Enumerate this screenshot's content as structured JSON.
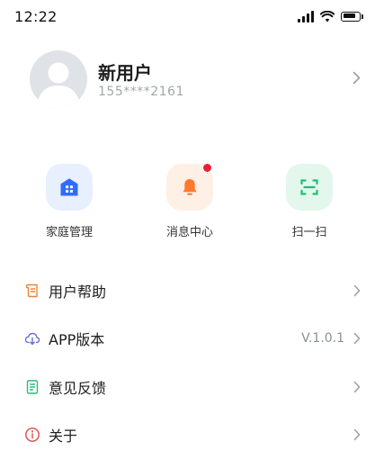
{
  "status_bar": {
    "time": "12:22",
    "battery_level": 0.85
  },
  "profile": {
    "name": "新用户",
    "phone": "155****2161"
  },
  "quick_actions": [
    {
      "label": "家庭管理",
      "icon": "home-grid-icon",
      "color": "#2f6bff"
    },
    {
      "label": "消息中心",
      "icon": "bell-icon",
      "color": "#ff7a2e",
      "has_badge": true
    },
    {
      "label": "扫一扫",
      "icon": "scan-icon",
      "color": "#1dbf73"
    }
  ],
  "menu": [
    {
      "label": "用户帮助",
      "icon": "scroll-icon",
      "value": ""
    },
    {
      "label": "APP版本",
      "icon": "cloud-download-icon",
      "value": "V.1.0.1"
    },
    {
      "label": "意见反馈",
      "icon": "document-icon",
      "value": ""
    },
    {
      "label": "关于",
      "icon": "info-icon",
      "value": ""
    }
  ]
}
